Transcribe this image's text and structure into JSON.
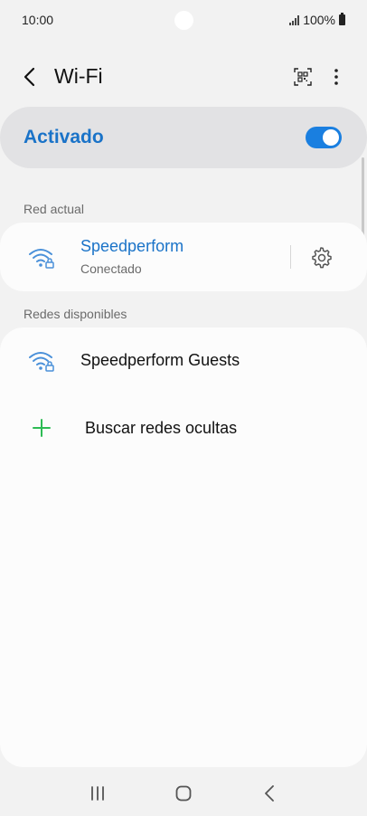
{
  "status_bar": {
    "time": "10:00",
    "battery": "100%",
    "icons": [
      "signal-icon",
      "battery-icon"
    ]
  },
  "header": {
    "title": "Wi-Fi",
    "back_icon": "chevron-left-icon",
    "qr_icon": "qr-scan-icon",
    "more_icon": "more-vertical-icon"
  },
  "master_switch": {
    "label": "Activado",
    "on": true,
    "accent": "#1a7fe0"
  },
  "current_network": {
    "section_label": "Red actual",
    "name": "Speedperform",
    "status": "Conectado",
    "icon": "wifi-lock-icon",
    "settings_icon": "gear-icon"
  },
  "available_networks": {
    "section_label": "Redes disponibles",
    "items": [
      {
        "name": "Speedperform Guests",
        "icon": "wifi-lock-icon"
      }
    ],
    "add_hidden_label": "Buscar redes ocultas",
    "add_icon": "plus-icon"
  },
  "nav_bar": {
    "icons": [
      "recents-icon",
      "home-icon",
      "back-icon"
    ]
  },
  "colors": {
    "accent_blue": "#1a73c8",
    "wifi_icon_blue": "#4a90d9",
    "plus_green": "#2dbb54"
  }
}
